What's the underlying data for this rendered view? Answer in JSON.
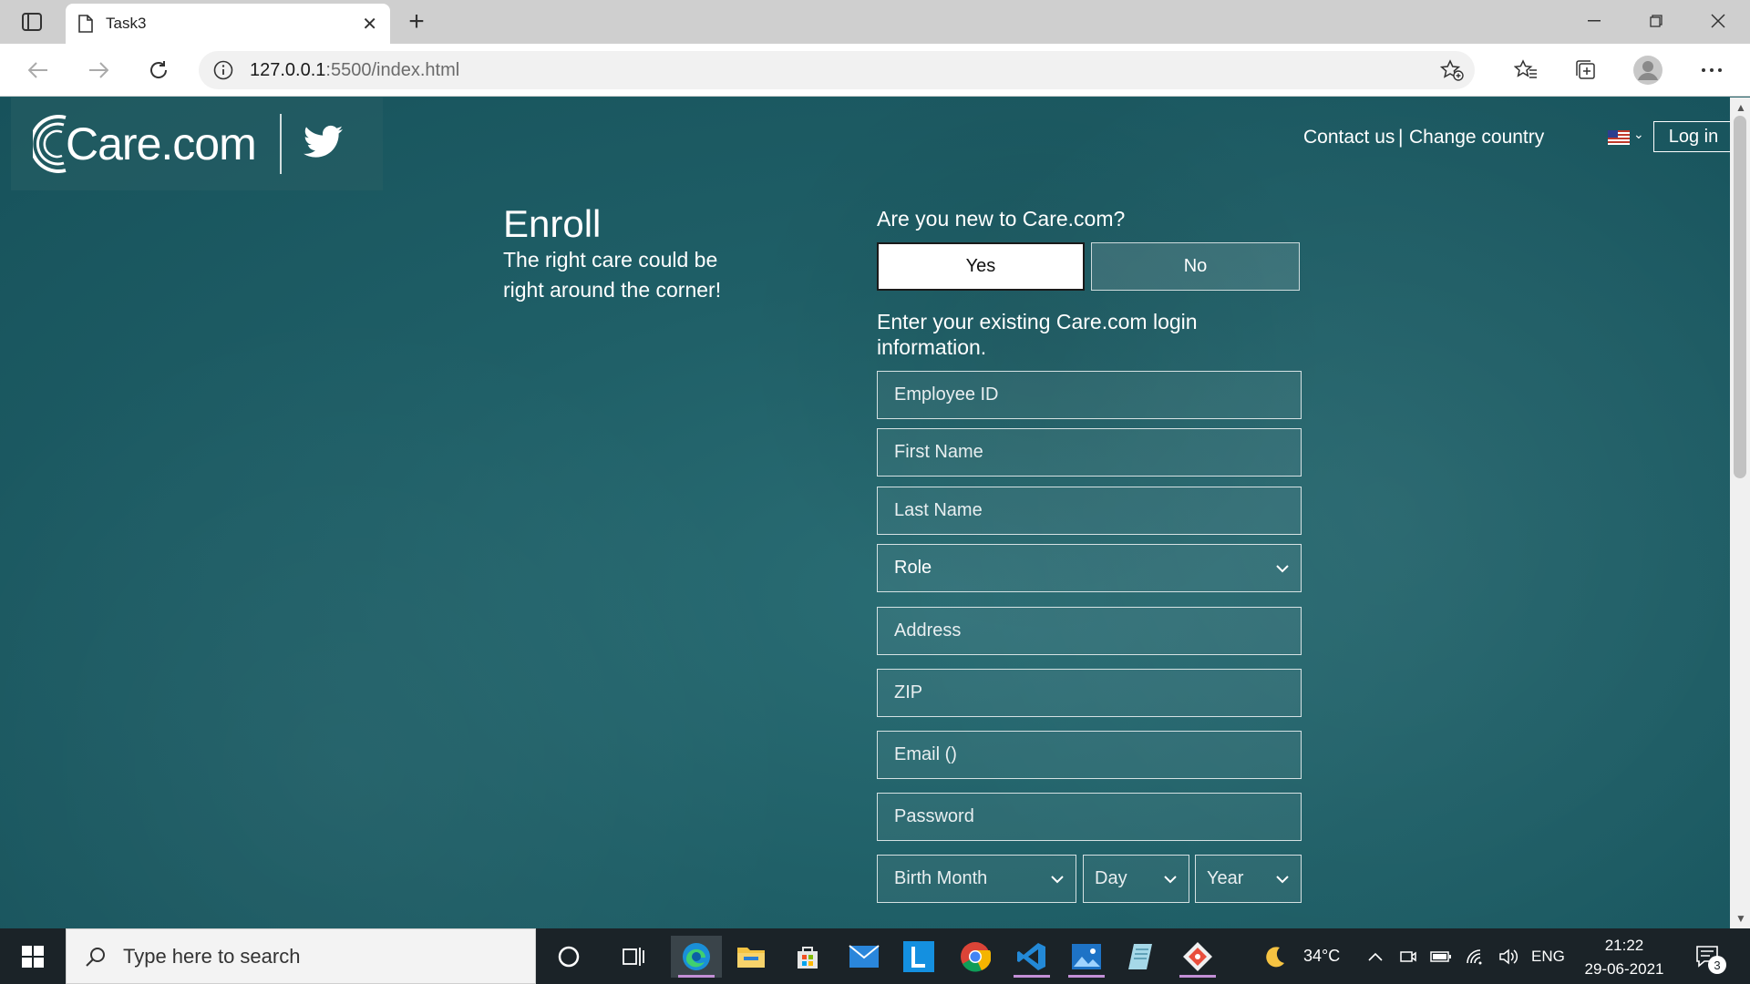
{
  "browser": {
    "tab_title": "Task3",
    "url_host": "127.0.0.1",
    "url_rest": ":5500/index.html"
  },
  "header": {
    "logo_text": "Care.com",
    "contact_link": "Contact us",
    "separator": "|",
    "change_country": "Change country",
    "login_label": "Log in"
  },
  "enroll": {
    "title": "Enroll",
    "subtitle": "The right care could be right around the corner!"
  },
  "form": {
    "question": "Are you new to Care.com?",
    "yes_label": "Yes",
    "no_label": "No",
    "info_label": "Enter your existing Care.com login information.",
    "employee_id": "Employee ID",
    "first_name": "First Name",
    "last_name": "Last Name",
    "role": "Role",
    "address": "Address",
    "zip": "ZIP",
    "email": "Email ()",
    "password": "Password",
    "birth_month": "Birth Month",
    "day": "Day",
    "year": "Year"
  },
  "taskbar": {
    "search_placeholder": "Type here to search",
    "temperature": "34°C",
    "language": "ENG",
    "time": "21:22",
    "date": "29-06-2021",
    "notification_count": "3"
  },
  "colors": {
    "page_bg": "#1f5e66",
    "accent_taskbar": "#c38fd6"
  }
}
